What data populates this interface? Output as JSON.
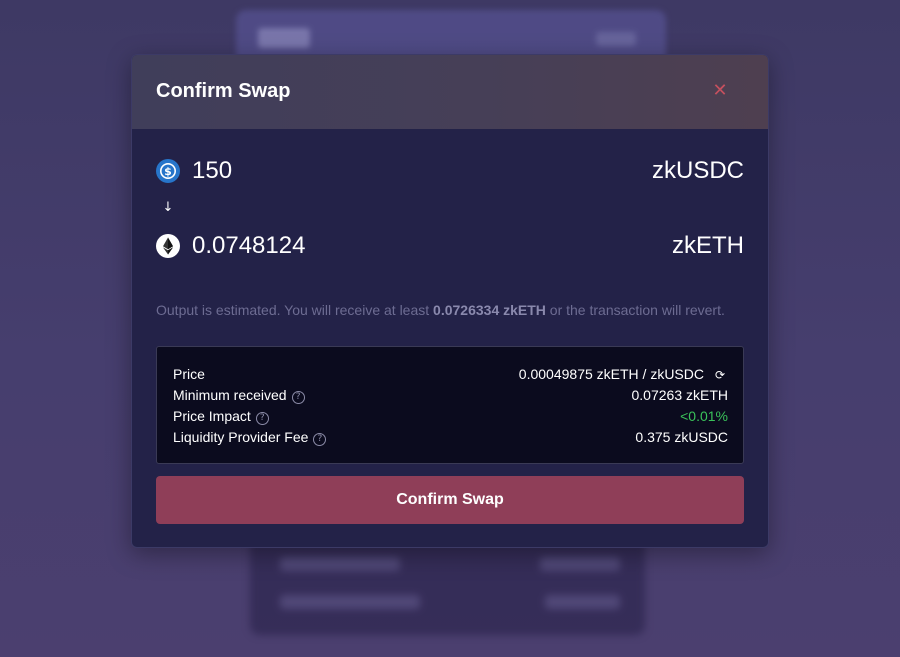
{
  "modal": {
    "title": "Confirm Swap",
    "close_icon": "close-icon",
    "close_glyph": "✕"
  },
  "input_token": {
    "amount": "150",
    "symbol": "zkUSDC",
    "icon": "usdc-icon",
    "icon_color": "#2775ca"
  },
  "arrow": {
    "icon": "arrow-down-icon",
    "glyph": "↓"
  },
  "output_token": {
    "amount": "0.0748124",
    "symbol": "zkETH",
    "icon": "eth-icon"
  },
  "estimate": {
    "prefix": "Output is estimated. You will receive at least ",
    "min_amount": "0.0726334 zkETH",
    "suffix": " or the transaction will revert."
  },
  "details": {
    "price": {
      "label": "Price",
      "value": "0.00049875 zkETH / zkUSDC",
      "icon": "refresh-icon",
      "glyph": "⟳"
    },
    "minimum_received": {
      "label": "Minimum received",
      "value": "0.07263 zkETH",
      "icon": "help-icon",
      "glyph": "?"
    },
    "price_impact": {
      "label": "Price Impact",
      "value": "<0.01%",
      "value_color": "#3ac25a",
      "icon": "help-icon",
      "glyph": "?"
    },
    "lp_fee": {
      "label": "Liquidity Provider Fee",
      "value": "0.375 zkUSDC",
      "icon": "help-icon",
      "glyph": "?"
    }
  },
  "confirm_button": {
    "label": "Confirm Swap",
    "color": "#8f3e58"
  },
  "colors": {
    "accent": "#8f3e58",
    "close": "#c5505e",
    "modal_bg": "#232248",
    "details_bg": "#0b0b1e"
  }
}
